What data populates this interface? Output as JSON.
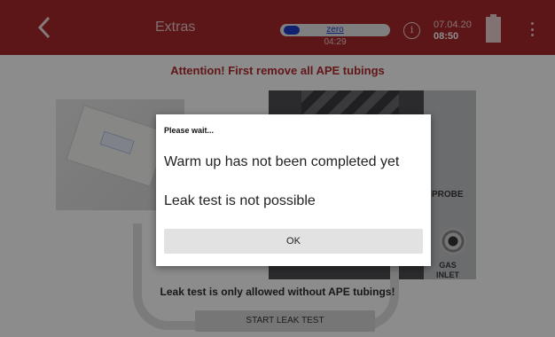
{
  "header": {
    "title": "Extras",
    "zero": {
      "label": "zero",
      "time": "04:29",
      "progress": 0.12
    },
    "date": "07.04.20",
    "time": "08:50",
    "icons": {
      "back": "chevron-left-icon",
      "info": "info-icon",
      "battery": "battery-icon",
      "menu": "more-vertical-icon"
    },
    "info_glyph": "i"
  },
  "main": {
    "attention": "Attention! First remove all APE tubings",
    "photo_labels": {
      "probe": "PROBE",
      "gas_inlet_line1": "GAS",
      "gas_inlet_line2": "INLET"
    },
    "leak_note": "Leak test is only allowed without APE tubings!",
    "start_button": "START LEAK TEST"
  },
  "dialog": {
    "title": "Please wait...",
    "message_1": "Warm up has not been completed yet",
    "message_2": "Leak test is not possible",
    "ok": "OK"
  },
  "colors": {
    "accent": "#a9292c",
    "attention_text": "#b32a2e",
    "zero_indicator": "#1f3cc9"
  }
}
